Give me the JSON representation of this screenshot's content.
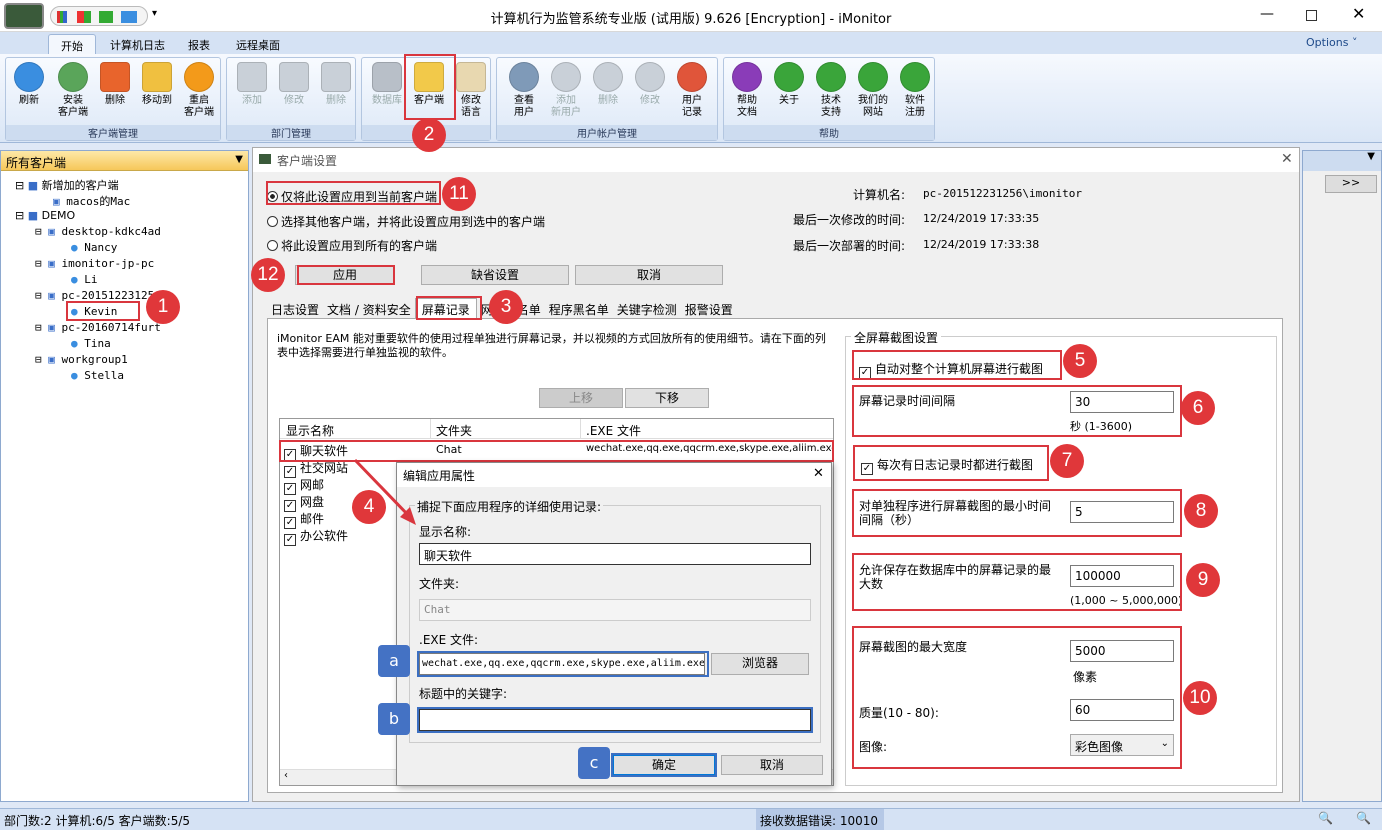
{
  "app": {
    "title": "计算机行为监管系统专业版 (试用版) 9.626 [Encryption] - iMonitor",
    "options": "Options ˅"
  },
  "tabs": [
    "开始",
    "计算机日志",
    "报表",
    "远程桌面"
  ],
  "ribbon": {
    "g1": {
      "label": "客户端管理",
      "buttons": [
        "刷新",
        "安装\n客户端",
        "删除",
        "移动到",
        "重启\n客户端"
      ]
    },
    "g2": {
      "label": "部门管理",
      "buttons": [
        "添加",
        "修改",
        "删除"
      ]
    },
    "g3": {
      "label": "",
      "buttons": [
        "数据库",
        "客户端",
        "修改\n语言"
      ]
    },
    "g4": {
      "label": "用户帐户管理",
      "buttons": [
        "查看\n用户",
        "添加\n新用户",
        "删除",
        "修改",
        "用户\n记录"
      ]
    },
    "g5": {
      "label": "帮助",
      "buttons": [
        "帮助\n文档",
        "关于",
        "技术\n支持",
        "我们的\n网站",
        "软件\n注册"
      ]
    }
  },
  "left": {
    "header": "所有客户端",
    "tree": [
      "新增加的客户端",
      "macos的Mac",
      "DEMO",
      "desktop-kdkc4ad",
      "Nancy",
      "Li",
      "imonitor-jp-pc",
      "pc-20151223125",
      "Kevin",
      "pc-20160714furt",
      "Tina",
      "workgroup1",
      "Stella"
    ]
  },
  "dialog": {
    "title": "客户端设置",
    "radio1": "仅将此设置应用到当前客户端",
    "radio2": "选择其他客户端，并将此设置应用到选中的客户端",
    "radio3": "将此设置应用到所有的客户端",
    "computer_label": "计算机名:",
    "computer_value": "pc-201512231256\\imonitor",
    "modified_label": "最后一次修改的时间:",
    "modified_value": "12/24/2019 17:33:35",
    "deployed_label": "最后一次部署的时间:",
    "deployed_value": "12/24/2019 17:33:38",
    "apply": "应用",
    "default": "缺省设置",
    "cancel": "取消",
    "subtabs": [
      "日志设置",
      "文档 / 资料安全",
      "屏幕记录",
      "网",
      "名单",
      "程序黑名单",
      "关键字检测",
      "报警设置"
    ],
    "desc": "iMonitor EAM 能对重要软件的使用过程单独进行屏幕记录，并以视频的方式回放所有的使用细节。请在下面的列表中选择需要进行单独监视的软件。",
    "up": "上移",
    "down": "下移",
    "cols": [
      "显示名称",
      "文件夹",
      ".EXE 文件"
    ],
    "apps": [
      "聊天软件",
      "社交网站",
      "网邮",
      "网盘",
      "邮件",
      "办公软件"
    ],
    "row1_folder": "Chat",
    "row1_exe": "wechat.exe,qq.exe,qqcrm.exe,skype.exe,aliim.exe,li"
  },
  "right": {
    "group": "全屏幕截图设置",
    "auto": "自动对整个计算机屏幕进行截图",
    "interval_label": "屏幕记录时间间隔",
    "interval": "30",
    "interval_hint": "秒 (1-3600)",
    "each": "每次有日志记录时都进行截图",
    "min_label": "对单独程序进行屏幕截图的最小时间间隔（秒）",
    "min": "5",
    "max_label": "允许保存在数据库中的屏幕记录的最大数",
    "max": "100000",
    "max_hint": "(1,000 ~ 5,000,000)",
    "width_label": "屏幕截图的最大宽度",
    "width": "5000",
    "width_unit": "像素",
    "quality_label": "质量(10 - 80):",
    "quality": "60",
    "image_label": "图像:",
    "image": "彩色图像"
  },
  "sub": {
    "title": "编辑应用属性",
    "caption": "捕捉下面应用程序的详细使用记录:",
    "name_label": "显示名称:",
    "name": "聊天软件",
    "folder_label": "文件夹:",
    "folder": "Chat",
    "exe_label": ".EXE 文件:",
    "exe": "wechat.exe,qq.exe,qqcrm.exe,skype.exe,aliim.exe",
    "browse": "浏览器",
    "kw_label": "标题中的关键字:",
    "kw": "",
    "ok": "确定",
    "cancel": "取消"
  },
  "badges": [
    "1",
    "2",
    "3",
    "4",
    "5",
    "6",
    "7",
    "8",
    "9",
    "10",
    "11",
    "12"
  ],
  "squares": [
    "a",
    "b",
    "c"
  ],
  "status": {
    "left": "部门数:2 计算机:6/5 客户端数:5/5",
    "mid": "接收数据错误: 10010"
  },
  "colors": {
    "red": "#d9363e",
    "blue": "#4472c4"
  }
}
